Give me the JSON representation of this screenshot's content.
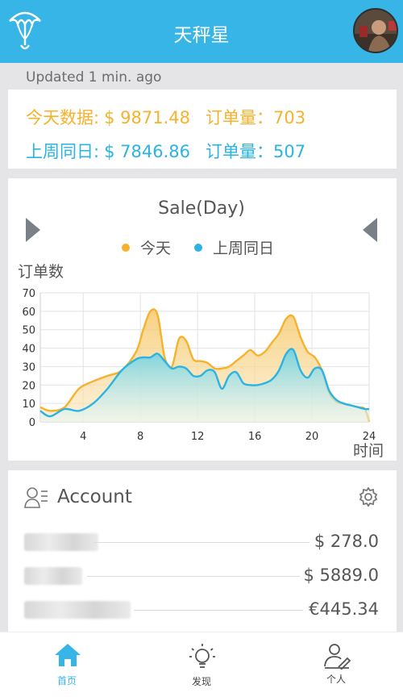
{
  "header": {
    "title": "天秤星"
  },
  "status": {
    "updated": "Updated 1 min. ago"
  },
  "summary": {
    "today_label": "今天数据:",
    "today_amount": "$ 9871.48",
    "today_orders": "订单量：703",
    "last_label": "上周同日:",
    "last_amount": "$ 7846.86",
    "last_orders": "订单量：507"
  },
  "chart_data": {
    "type": "area",
    "title": "Sale(Day)",
    "ylabel": "订单数",
    "xlabel": "时间",
    "xlim": [
      1,
      24
    ],
    "ylim": [
      0,
      70
    ],
    "x_ticks": [
      4,
      8,
      12,
      16,
      20,
      24
    ],
    "y_ticks": [
      0,
      10,
      20,
      30,
      40,
      50,
      60,
      70
    ],
    "x": [
      1,
      1.7,
      2.7,
      3.7,
      4.7,
      5.7,
      6.7,
      7.7,
      8.2,
      8.7,
      9.2,
      9.7,
      10.2,
      10.7,
      11.2,
      11.7,
      12.2,
      12.7,
      13.2,
      13.7,
      14.2,
      14.7,
      15.2,
      15.7,
      16.2,
      16.7,
      17.2,
      17.7,
      18.2,
      18.7,
      19.2,
      19.7,
      20.2,
      20.7,
      21.2,
      21.7,
      22.2,
      22.7,
      23.2,
      23.7,
      24
    ],
    "grid": true,
    "legend_position": "top-center",
    "series": [
      {
        "name": "今天",
        "color": "#f6b22c",
        "values": [
          8,
          6,
          8,
          18,
          22,
          25,
          28,
          38,
          50,
          60,
          58,
          35,
          30,
          45,
          44,
          34,
          33,
          32,
          29,
          29,
          30,
          33,
          36,
          39,
          36,
          38,
          43,
          48,
          56,
          57,
          46,
          38,
          35,
          28,
          16,
          11,
          10,
          9,
          8,
          7,
          0
        ]
      },
      {
        "name": "上周同日",
        "color": "#2ab3e3",
        "values": [
          6,
          3,
          7,
          6,
          10,
          18,
          28,
          34,
          35,
          35,
          37,
          33,
          29,
          30,
          29,
          25,
          25,
          28,
          27,
          18,
          25,
          27,
          21,
          20,
          20,
          21,
          23,
          28,
          37,
          39,
          28,
          24,
          29,
          28,
          17,
          12,
          10,
          9,
          8,
          7,
          7
        ]
      }
    ]
  },
  "account": {
    "title": "Account",
    "items": [
      {
        "value": "$ 278.0"
      },
      {
        "value": "$ 5889.0"
      },
      {
        "value": "€445.34"
      }
    ]
  },
  "tabs": [
    {
      "label": "首页",
      "color": "#36b5e6"
    },
    {
      "label": "发现"
    },
    {
      "label": "个人"
    }
  ]
}
